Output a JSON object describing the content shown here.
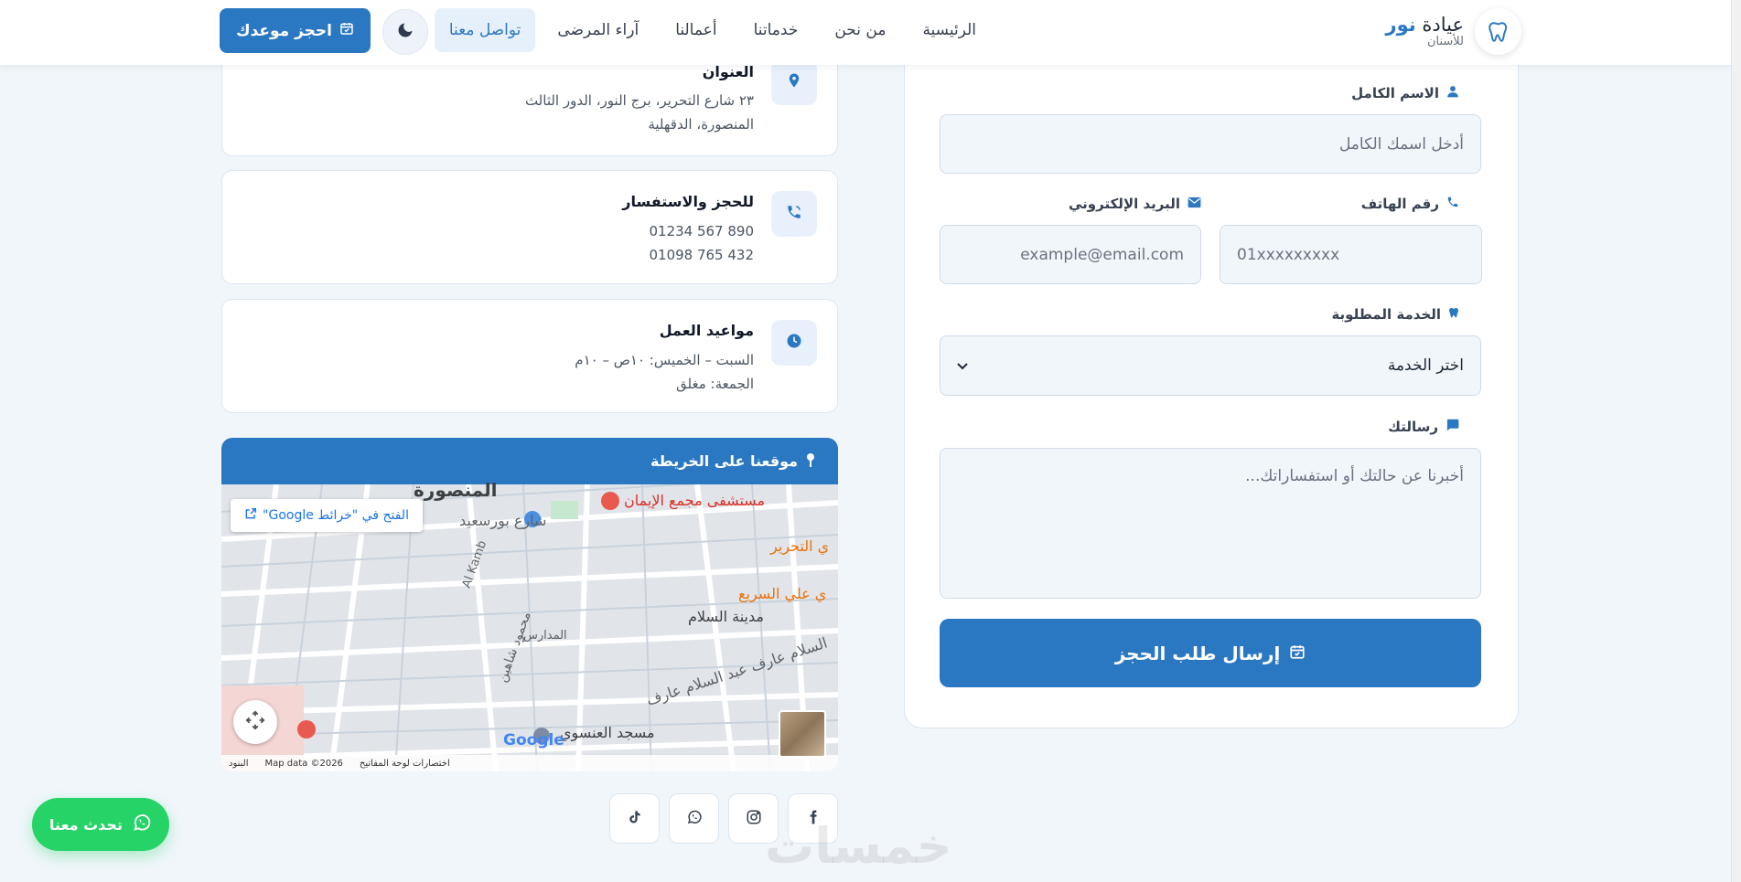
{
  "header": {
    "logo_brand": "عيادة",
    "logo_highlight": "نور",
    "logo_sub": "للأسنان",
    "nav": [
      "الرئيسية",
      "من نحن",
      "خدماتنا",
      "أعمالنا",
      "آراء المرضى",
      "تواصل معنا"
    ],
    "active_nav": "تواصل معنا",
    "book_label": "احجز موعدك"
  },
  "contact": {
    "address_title": "العنوان",
    "address_line1": "٢٣ شارع التحرير، برج النور، الدور الثالث",
    "address_line2": "المنصورة، الدقهلية",
    "phone_title": "للحجز والاستفسار",
    "phone1": "01234 567 890",
    "phone2": "01098 765 432",
    "hours_title": "مواعيد العمل",
    "hours_line1": "السبت – الخميس: ١٠ص – ١٠م",
    "hours_line2": "الجمعة: مغلق"
  },
  "map": {
    "title": "موقعنا على الخريطة",
    "open_label": "الفتح في \"خرائط Google\"",
    "labels": {
      "city": "المنصورة",
      "hospital": "مستشفى مجمع الإيمان",
      "street1": "شارع بورسعيد",
      "tahrir": "ي التحرير",
      "sarie": "ي علي السريع",
      "salam": "مدينة السلام",
      "aref": "السلام عارف عبد السلام عارف",
      "mosque": "مسجد العنسوي",
      "alkamb": "Al Kamb",
      "madares": "المدارس",
      "mahmoud": "محمود شاهين"
    },
    "footer_shortcuts": "اختصارات لوحة المفاتيح",
    "footer_data": "Map data ©2026",
    "footer_terms": "البنود",
    "google": "Google"
  },
  "form": {
    "name_label": "الاسم الكامل",
    "name_placeholder": "أدخل اسمك الكامل",
    "phone_label": "رقم الهاتف",
    "phone_placeholder": "01xxxxxxxxx",
    "email_label": "البريد الإلكتروني",
    "email_placeholder": "example@email.com",
    "service_label": "الخدمة المطلوبة",
    "service_selected": "اختر الخدمة",
    "message_label": "رسالتك",
    "message_placeholder": "أخبرنا عن حالتك أو استفساراتك...",
    "submit_label": "إرسال طلب الحجز"
  },
  "chat_label": "تحدث معنا",
  "watermark": "خمسات",
  "colors": {
    "primary": "#2b78c2",
    "whatsapp": "#25d366",
    "page_bg": "#f1f6fb"
  },
  "social_icons": [
    "facebook-icon",
    "instagram-icon",
    "whatsapp-icon",
    "tiktok-icon"
  ]
}
